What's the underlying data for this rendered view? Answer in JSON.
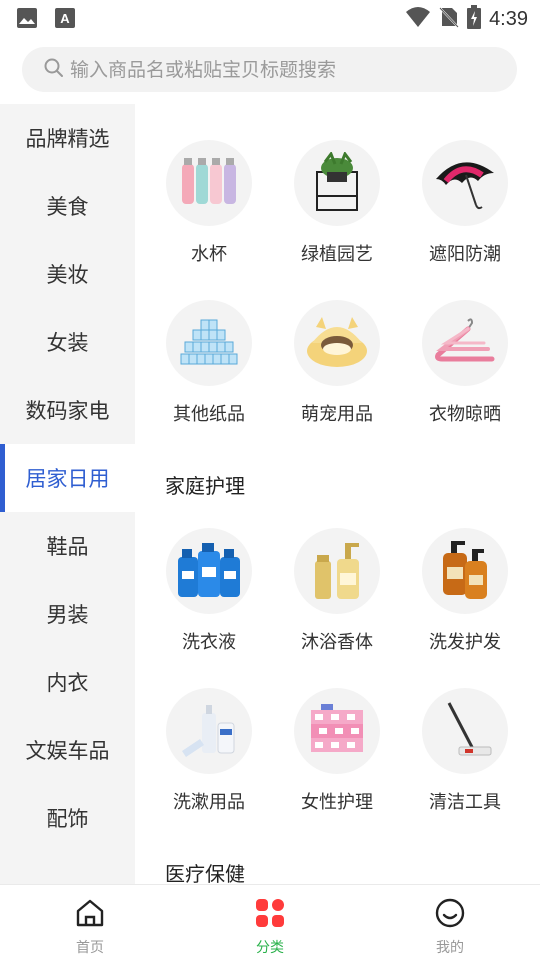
{
  "status_bar": {
    "time": "4:39"
  },
  "search": {
    "placeholder": "输入商品名或粘贴宝贝标题搜索"
  },
  "sidebar": {
    "items": [
      {
        "label": "品牌精选"
      },
      {
        "label": "美食"
      },
      {
        "label": "美妆"
      },
      {
        "label": "女装"
      },
      {
        "label": "数码家电"
      },
      {
        "label": "居家日用",
        "active": true
      },
      {
        "label": "鞋品"
      },
      {
        "label": "男装"
      },
      {
        "label": "内衣"
      },
      {
        "label": "文娱车品"
      },
      {
        "label": "配饰"
      }
    ]
  },
  "content": {
    "row1": [
      {
        "label": "水杯",
        "icon": "water-bottles-icon"
      },
      {
        "label": "绿植园艺",
        "icon": "potted-plant-icon"
      },
      {
        "label": "遮阳防潮",
        "icon": "umbrella-icon"
      }
    ],
    "row2": [
      {
        "label": "其他纸品",
        "icon": "tissue-stack-icon"
      },
      {
        "label": "萌宠用品",
        "icon": "pet-bed-icon"
      },
      {
        "label": "衣物晾晒",
        "icon": "hangers-icon"
      }
    ],
    "section_home_care": "家庭护理",
    "row3": [
      {
        "label": "洗衣液",
        "icon": "laundry-detergent-icon"
      },
      {
        "label": "沐浴香体",
        "icon": "body-wash-icon"
      },
      {
        "label": "洗发护发",
        "icon": "shampoo-icon"
      }
    ],
    "row4": [
      {
        "label": "洗漱用品",
        "icon": "toiletries-icon"
      },
      {
        "label": "女性护理",
        "icon": "sanitary-pads-icon"
      },
      {
        "label": "清洁工具",
        "icon": "mop-icon"
      }
    ],
    "section_health": "医疗保健"
  },
  "bottom_nav": {
    "home": "首页",
    "category": "分类",
    "mine": "我的"
  },
  "colors": {
    "accent_blue": "#2f5ed1",
    "nav_active_red": "#ff3b3b",
    "nav_active_green": "#2bb24c"
  }
}
